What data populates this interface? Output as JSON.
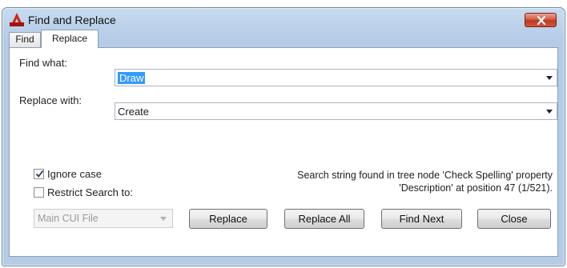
{
  "window": {
    "title": "Find and Replace",
    "icon": "autocad-icon",
    "accent_color": "#c0381f"
  },
  "tabs": [
    {
      "label": "Find",
      "active": false
    },
    {
      "label": "Replace",
      "active": true
    }
  ],
  "form": {
    "find_label": "Find what:",
    "find_value": "Draw",
    "replace_label": "Replace with:",
    "replace_value": "Create"
  },
  "options": {
    "ignore_case": {
      "label": "Ignore case",
      "checked": true
    },
    "restrict_search": {
      "label": "Restrict Search to:",
      "checked": false
    },
    "restrict_select_value": "Main CUI File"
  },
  "status": {
    "line1": "Search string found in tree node 'Check Spelling' property",
    "line2": "'Description' at position 47 (1/521)."
  },
  "buttons": {
    "replace": "Replace",
    "replace_all": "Replace All",
    "find_next": "Find Next",
    "close": "Close"
  }
}
